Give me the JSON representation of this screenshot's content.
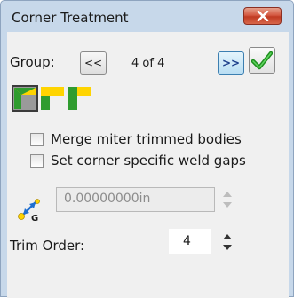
{
  "window": {
    "title": "Corner Treatment",
    "close_icon": "close-x-icon"
  },
  "group": {
    "label": "Group:",
    "prev_label": "<<",
    "position_text": "4 of 4",
    "next_label": ">>",
    "ok_icon": "green-checkmark-icon"
  },
  "treatments": [
    {
      "icon": "miter-corner-icon",
      "selected": true
    },
    {
      "icon": "overlap-corner-icon",
      "selected": false
    },
    {
      "icon": "butt-corner-icon",
      "selected": false
    }
  ],
  "options": {
    "merge_label": "Merge miter trimmed bodies",
    "merge_checked": false,
    "weld_label": "Set corner specific weld gaps",
    "weld_checked": false
  },
  "weld_gap": {
    "icon": "weld-gap-icon",
    "icon_letter": "G",
    "value": "0.00000000in",
    "enabled": false
  },
  "trim_order": {
    "label": "Trim Order:",
    "value": "4"
  },
  "colors": {
    "frame": "#c7d8ea",
    "client": "#f0f0f0",
    "close_red": "#c9452c",
    "check_green": "#2aa82a",
    "treatment_green": "#2f9c2f",
    "treatment_yellow": "#ffd400"
  }
}
